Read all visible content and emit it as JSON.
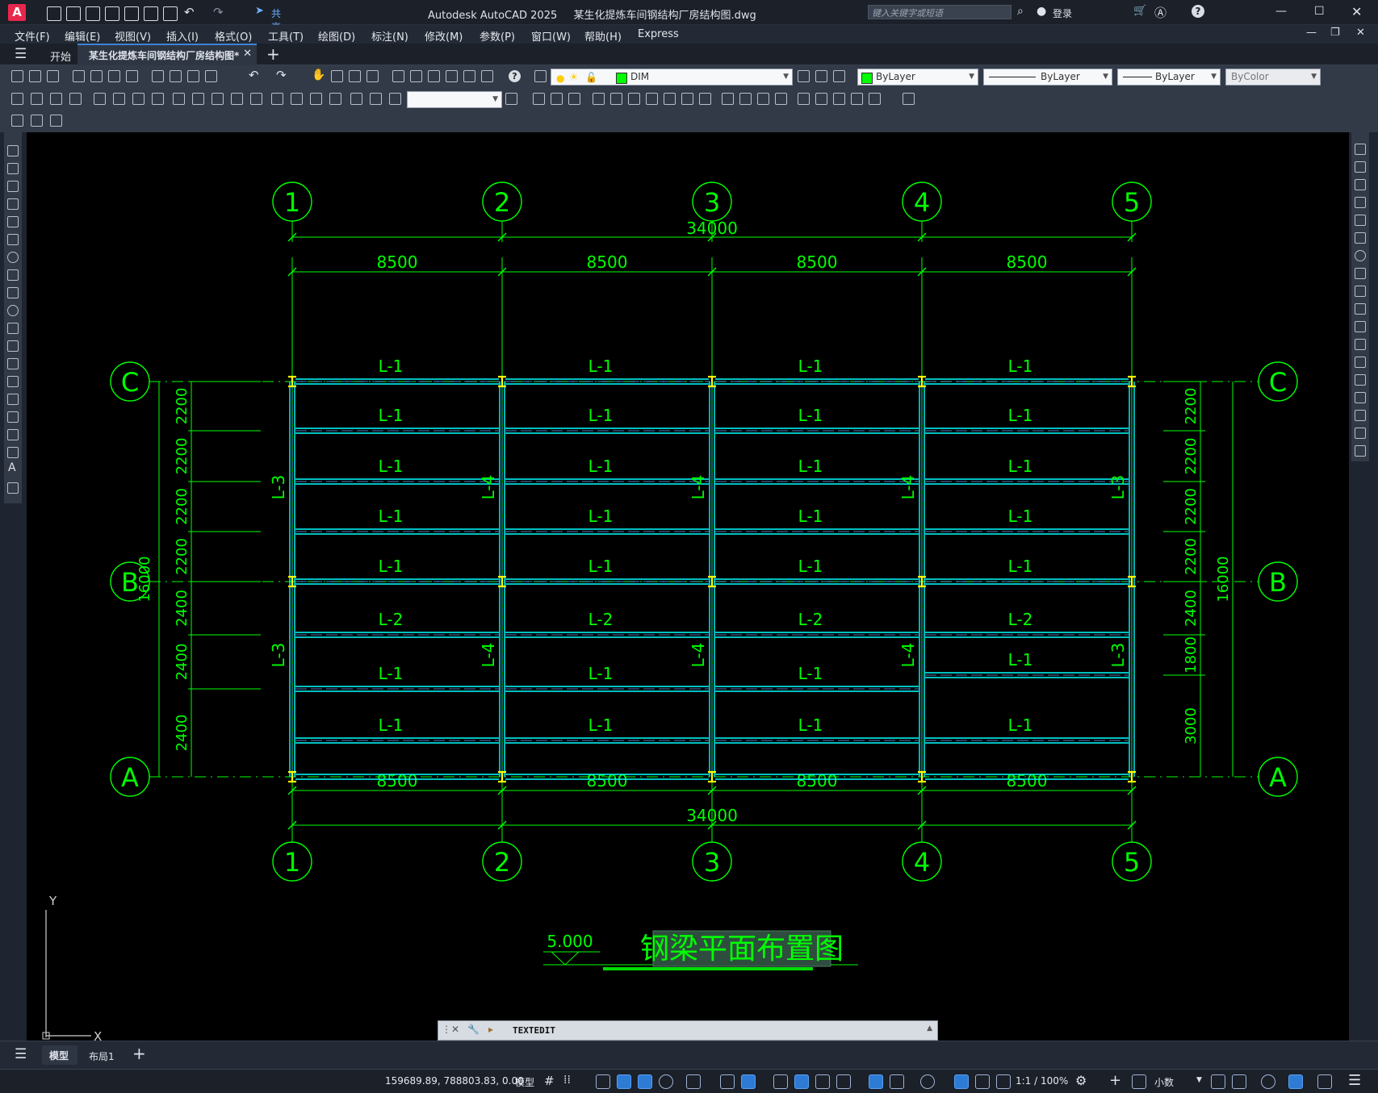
{
  "app": {
    "title": "Autodesk AutoCAD 2025",
    "document": "某生化提炼车间钢结构厂房结构图.dwg",
    "share": "共享",
    "search_placeholder": "键入关键字或短语",
    "login": "登录"
  },
  "menu": [
    "文件(F)",
    "编辑(E)",
    "视图(V)",
    "插入(I)",
    "格式(O)",
    "工具(T)",
    "绘图(D)",
    "标注(N)",
    "修改(M)",
    "参数(P)",
    "窗口(W)",
    "帮助(H)",
    "Express"
  ],
  "tabs": {
    "start": "开始",
    "active": "某生化提炼车间钢结构厂房结构图*"
  },
  "props": {
    "layer": "DIM",
    "color": "ByLayer",
    "linetype": "ByLayer",
    "lineweight": "ByLayer",
    "plotstyle": "ByColor"
  },
  "drawing": {
    "col_labels": [
      "1",
      "2",
      "3",
      "4",
      "5"
    ],
    "row_labels": [
      "C",
      "B",
      "A"
    ],
    "total_width": "34000",
    "bay_widths": [
      "8500",
      "8500",
      "8500",
      "8500"
    ],
    "total_depth": "16000",
    "left_spacings": [
      "2200",
      "2200",
      "2200",
      "2200",
      "2400",
      "2400",
      "2400"
    ],
    "right_spacings": [
      "2200",
      "2200",
      "2200",
      "2200",
      "2400",
      "1800",
      "3000"
    ],
    "beam_rows": [
      [
        "L-1",
        "L-1",
        "L-1",
        "L-1"
      ],
      [
        "L-1",
        "L-1",
        "L-1",
        "L-1"
      ],
      [
        "L-1",
        "L-1",
        "L-1",
        "L-1"
      ],
      [
        "L-1",
        "L-1",
        "L-1",
        "L-1"
      ],
      [
        "L-1",
        "L-1",
        "L-1",
        "L-1"
      ],
      [
        "L-2",
        "L-2",
        "L-2",
        "L-2"
      ],
      [
        "L-1",
        "L-1",
        "L-1",
        "L-1"
      ],
      [
        "L-1",
        "L-1",
        "L-1",
        "L-1"
      ]
    ],
    "vertical_labels": [
      "L-3",
      "L-4",
      "L-4",
      "L-4",
      "L-3"
    ],
    "elevation": "5.000",
    "title": "钢梁平面布置图",
    "ucs_x": "X",
    "ucs_y": "Y"
  },
  "command": {
    "text": "TEXTEDIT"
  },
  "layout_tabs": [
    "模型",
    "布局1"
  ],
  "status": {
    "coords": "159689.89, 788803.83, 0.00",
    "mode": "模型",
    "scale": "1:1 / 100%",
    "units": "小数"
  },
  "colors": {
    "grid": "#00ff00",
    "beam": "#00ffff",
    "column": "#ffff00",
    "accent": "#e8274c"
  }
}
